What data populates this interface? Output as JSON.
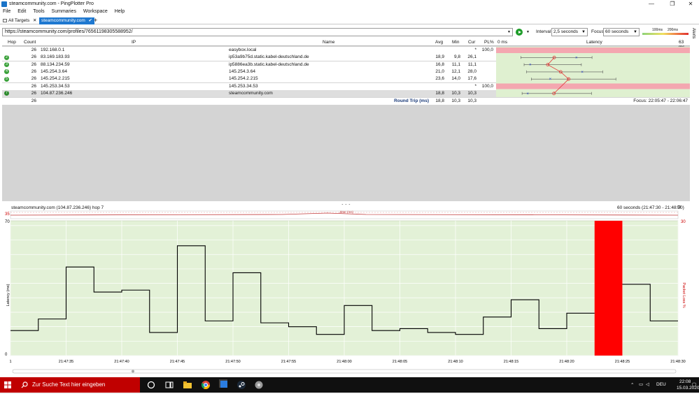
{
  "window": {
    "title": "steamcommunity.com - PingPlotter Pro",
    "buttons": {
      "min": "—",
      "max": "❐",
      "close": "✕"
    }
  },
  "menu": [
    "File",
    "Edit",
    "Tools",
    "Summaries",
    "Workspace",
    "Help"
  ],
  "tabs": {
    "all_targets": "All Targets",
    "active": "steamcommunity.com",
    "add": "+"
  },
  "toolbar": {
    "url": "https://steamcommunity.com/profiles/76561198305588952/",
    "interval_label": "Interval",
    "interval_value": "2,5 seconds",
    "focus_label": "Focus",
    "focus_value": "60 seconds",
    "legend_100": "100ms",
    "legend_200": "200ms"
  },
  "alerts_label": "Alerts",
  "trace": {
    "headers": {
      "hop": "Hop",
      "count": "Count",
      "ip": "IP",
      "name": "Name",
      "avg": "Avg",
      "min": "Min",
      "cur": "Cur",
      "pl": "PL%",
      "zero": "0 ms",
      "latency": "Latency",
      "max": "63 ms"
    },
    "rows": [
      {
        "hop": "",
        "count": "26",
        "ip": "192.168.0.1",
        "name": "easybox.local",
        "avg": "",
        "min": "",
        "cur": "*",
        "pl": "100,0",
        "loss": true
      },
      {
        "hop": "2",
        "count": "26",
        "ip": "83.169.183.93",
        "name": "ip53a9b75d.static.kabel-deutschland.de",
        "avg": "18,9",
        "min": "9,8",
        "cur": "26,1",
        "pl": "",
        "loss": false
      },
      {
        "hop": "3",
        "count": "26",
        "ip": "88.134.234.59",
        "name": "ip5886ea3b.static.kabel-deutschland.de",
        "avg": "16,8",
        "min": "11,1",
        "cur": "11,1",
        "pl": "",
        "loss": false
      },
      {
        "hop": "4",
        "count": "26",
        "ip": "145.254.3.64",
        "name": "145.254.3.64",
        "avg": "21,0",
        "min": "12,1",
        "cur": "28,0",
        "pl": "",
        "loss": false
      },
      {
        "hop": "5",
        "count": "26",
        "ip": "145.254.2.215",
        "name": "145.254.2.215",
        "avg": "23,6",
        "min": "14,0",
        "cur": "17,6",
        "pl": "",
        "loss": false
      },
      {
        "hop": "",
        "count": "26",
        "ip": "145.253.34.53",
        "name": "145.253.34.53",
        "avg": "",
        "min": "",
        "cur": "*",
        "pl": "100,0",
        "loss": true
      },
      {
        "hop": "7",
        "count": "26",
        "ip": "104.87.236.246",
        "name": "steamcommunity.com",
        "avg": "18,8",
        "min": "10,3",
        "cur": "10,3",
        "pl": "",
        "loss": false
      }
    ],
    "summary": {
      "count": "26",
      "label": "Round Trip (ms)",
      "avg": "18,8",
      "min": "10,3",
      "cur": "10,3",
      "focus": "Focus: 22:05:47 - 22:06:47"
    }
  },
  "timeline": {
    "target": "steamcommunity.com (104.87.236.246) hop 7",
    "range": "60 seconds (21:47:30 - 21:48:30)",
    "jitter_label": "Jitter (ms)",
    "jitter_max": "35",
    "ylabel": "Latency (ms)",
    "y2label": "Packet Loss %",
    "y_max": "70",
    "y_zero": "0",
    "pl_max": "30",
    "tick_start": "1",
    "x_ticks": [
      "21:47:35",
      "21:47:40",
      "21:47:45",
      "21:47:50",
      "21:47:55",
      "21:48:00",
      "21:48:05",
      "21:48:10",
      "21:48:15",
      "21:48:20",
      "21:48:25",
      "21:48:30"
    ]
  },
  "chart_data": {
    "type": "line",
    "title": "steamcommunity.com (104.87.236.246) hop 7",
    "xlabel": "",
    "ylabel": "Latency (ms)",
    "ylim": [
      0,
      70
    ],
    "x": [
      "21:47:30",
      "21:47:32.5",
      "21:47:35",
      "21:47:37.5",
      "21:47:40",
      "21:47:42.5",
      "21:47:45",
      "21:47:47.5",
      "21:47:50",
      "21:47:52.5",
      "21:47:55",
      "21:47:57.5",
      "21:48:00",
      "21:48:02.5",
      "21:48:05",
      "21:48:07.5",
      "21:48:10",
      "21:48:12.5",
      "21:48:15",
      "21:48:17.5",
      "21:48:20",
      "21:48:22.5",
      "21:48:25",
      "21:48:27.5",
      "21:48:30"
    ],
    "series": [
      {
        "values": [
          13,
          19,
          46,
          33,
          34,
          12,
          57,
          18,
          43,
          17,
          15,
          11,
          26,
          13,
          14,
          12,
          11,
          20,
          29,
          14,
          22,
          null,
          37,
          18,
          14
        ]
      }
    ],
    "packet_loss_window": [
      "21:48:22.5",
      "21:48:25"
    ],
    "grid": true
  }
}
